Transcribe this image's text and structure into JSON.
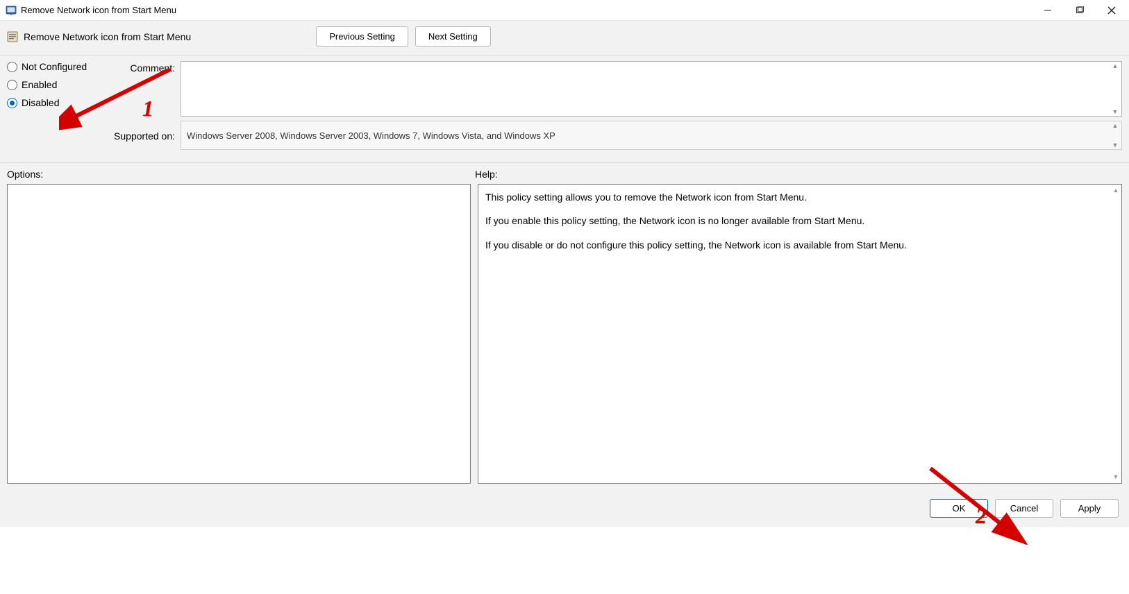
{
  "window": {
    "title": "Remove Network icon from Start Menu"
  },
  "header": {
    "policy_name": "Remove Network icon from Start Menu",
    "prev_button": "Previous Setting",
    "next_button": "Next Setting"
  },
  "config": {
    "radios": {
      "not_configured": "Not Configured",
      "enabled": "Enabled",
      "disabled": "Disabled",
      "selected": "disabled"
    },
    "comment_label": "Comment:",
    "comment_value": "",
    "supported_label": "Supported on:",
    "supported_value": "Windows Server 2008, Windows Server 2003, Windows 7, Windows Vista, and Windows XP"
  },
  "panels": {
    "options_label": "Options:",
    "help_label": "Help:",
    "help_p1": "This policy setting allows you to remove the Network icon from Start Menu.",
    "help_p2": "If you enable this policy setting, the Network icon is no longer available from Start Menu.",
    "help_p3": "If you disable or do not configure this policy setting, the Network icon is available from Start Menu."
  },
  "footer": {
    "ok": "OK",
    "cancel": "Cancel",
    "apply": "Apply"
  },
  "annotations": {
    "one": "1",
    "two": "2"
  }
}
